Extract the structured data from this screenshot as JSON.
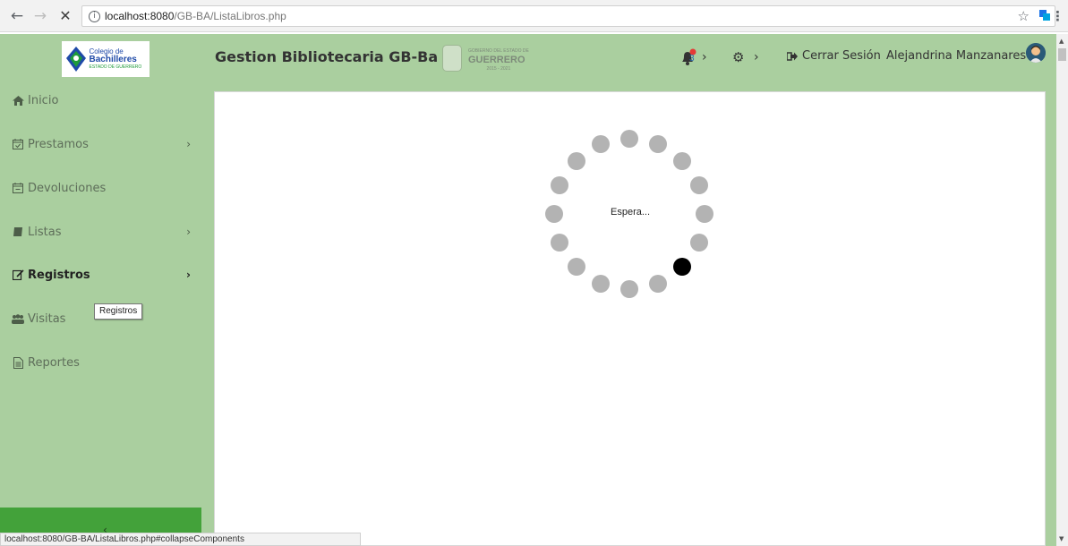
{
  "browser": {
    "url_host": "localhost:8080",
    "url_path": "/GB-BA/ListaLibros.php",
    "status_url": "localhost:8080/GB-BA/ListaLibros.php#collapseComponents"
  },
  "header": {
    "logo": {
      "line1": "Colegio de",
      "line2": "Bachilleres",
      "line3": "ESTADO DE GUERRERO"
    },
    "title": "Gestion Bibliotecaria GB-Ba",
    "gov": {
      "line1": "GOBIERNO DEL ESTADO DE",
      "line2": "GUERRERO",
      "line3": "2015 - 2021"
    },
    "notifications_count": "3",
    "logout_label": "Cerrar Sesión",
    "user_name": "Alejandrina Manzanares"
  },
  "sidebar": {
    "items": [
      {
        "label": "Inicio",
        "icon": "home-icon",
        "has_arrow": false,
        "active": false
      },
      {
        "label": "Prestamos",
        "icon": "calendar-icon",
        "has_arrow": true,
        "active": false
      },
      {
        "label": "Devoluciones",
        "icon": "calendar-icon",
        "has_arrow": false,
        "active": false
      },
      {
        "label": "Listas",
        "icon": "book-icon",
        "has_arrow": true,
        "active": false
      },
      {
        "label": "Registros",
        "icon": "edit-icon",
        "has_arrow": true,
        "active": true
      },
      {
        "label": "Visitas",
        "icon": "users-icon",
        "has_arrow": false,
        "active": false
      },
      {
        "label": "Reportes",
        "icon": "report-icon",
        "has_arrow": false,
        "active": false
      }
    ],
    "tooltip": "Registros",
    "collapse_glyph": "‹"
  },
  "main": {
    "loading_text": "Espera...",
    "spinner": {
      "dot_count": 16,
      "active_dot": 6
    }
  },
  "colors": {
    "header_bg": "#aacf9f",
    "sidebar_bg": "#aacf9f",
    "collapse_bar": "#43a23a",
    "spinner_dot": "#b3b3b3",
    "spinner_active": "#000000",
    "notification_red": "#e53935"
  }
}
